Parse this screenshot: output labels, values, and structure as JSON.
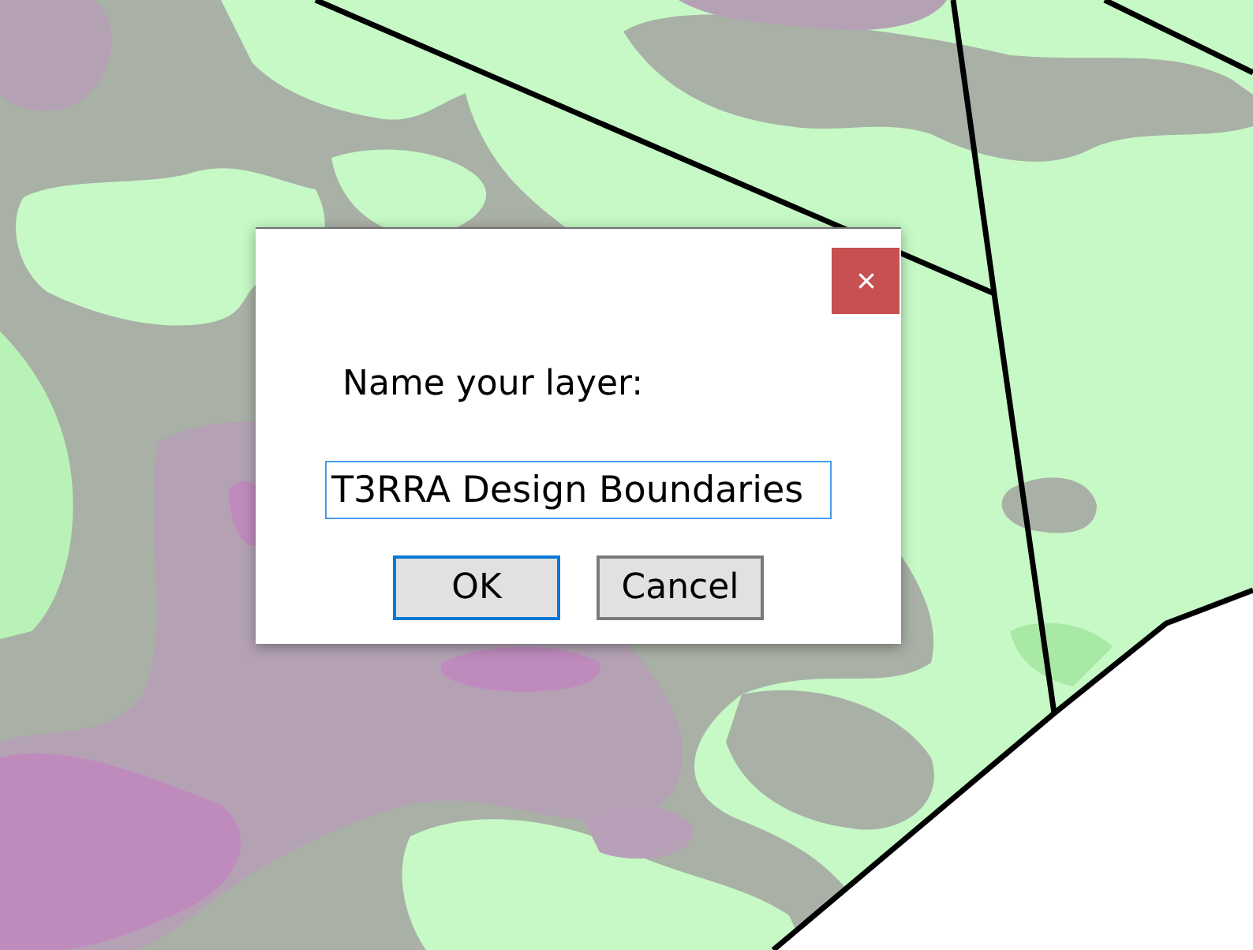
{
  "dialog": {
    "prompt": "Name your layer:",
    "name_field": {
      "value": "T3RRA Design Boundaries",
      "focused": true
    },
    "buttons": [
      {
        "label": "OK",
        "default": true
      },
      {
        "label": "Cancel",
        "default": false
      }
    ]
  }
}
